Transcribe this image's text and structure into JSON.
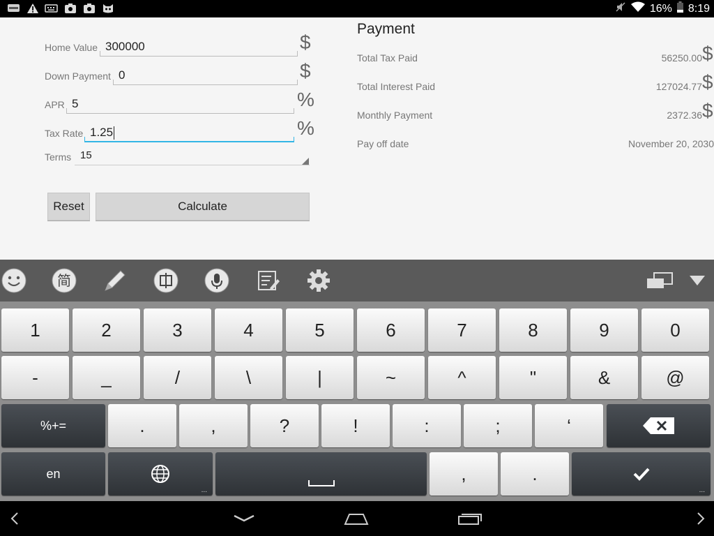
{
  "status_bar": {
    "battery": "16%",
    "time": "8:19",
    "notification_icons": [
      "news-icon",
      "warning-icon",
      "keyboard-icon",
      "app-icon",
      "app-icon",
      "cat-icon"
    ]
  },
  "form": {
    "home_value": {
      "label": "Home Value",
      "value": "300000",
      "unit": "$"
    },
    "down_payment": {
      "label": "Down Payment",
      "value": "0",
      "unit": "$"
    },
    "apr": {
      "label": "APR",
      "value": "5",
      "unit": "%"
    },
    "tax_rate": {
      "label": "Tax Rate",
      "value": "1.25",
      "unit": "%"
    },
    "terms": {
      "label": "Terms",
      "value": "15"
    },
    "reset_label": "Reset",
    "calculate_label": "Calculate"
  },
  "payment": {
    "title": "Payment",
    "total_tax": {
      "label": "Total Tax Paid",
      "value": "56250.00",
      "unit": "$"
    },
    "total_interest": {
      "label": "Total Interest Paid",
      "value": "127024.77",
      "unit": "$"
    },
    "monthly": {
      "label": "Monthly Payment",
      "value": "2372.36",
      "unit": "$"
    },
    "payoff": {
      "label": "Pay off date",
      "value": "November 20, 2030"
    }
  },
  "keyboard": {
    "row1": [
      "1",
      "2",
      "3",
      "4",
      "5",
      "6",
      "7",
      "8",
      "9",
      "0"
    ],
    "row2": [
      "-",
      "_",
      "/",
      "\\",
      "|",
      "~",
      "^",
      "\"",
      "&",
      "@"
    ],
    "row3_mode": "%+=",
    "row3": [
      ".",
      ",",
      "?",
      "!",
      ":",
      ";",
      "‘"
    ],
    "row4_lang": "en",
    "row4_comma": ",",
    "row4_period": "."
  },
  "colors": {
    "accent": "#33b5e5",
    "app_bg": "#f5f5f5",
    "keyboard_bg": "#8e8e8e",
    "toolbar_bg": "#5a5a5a"
  }
}
